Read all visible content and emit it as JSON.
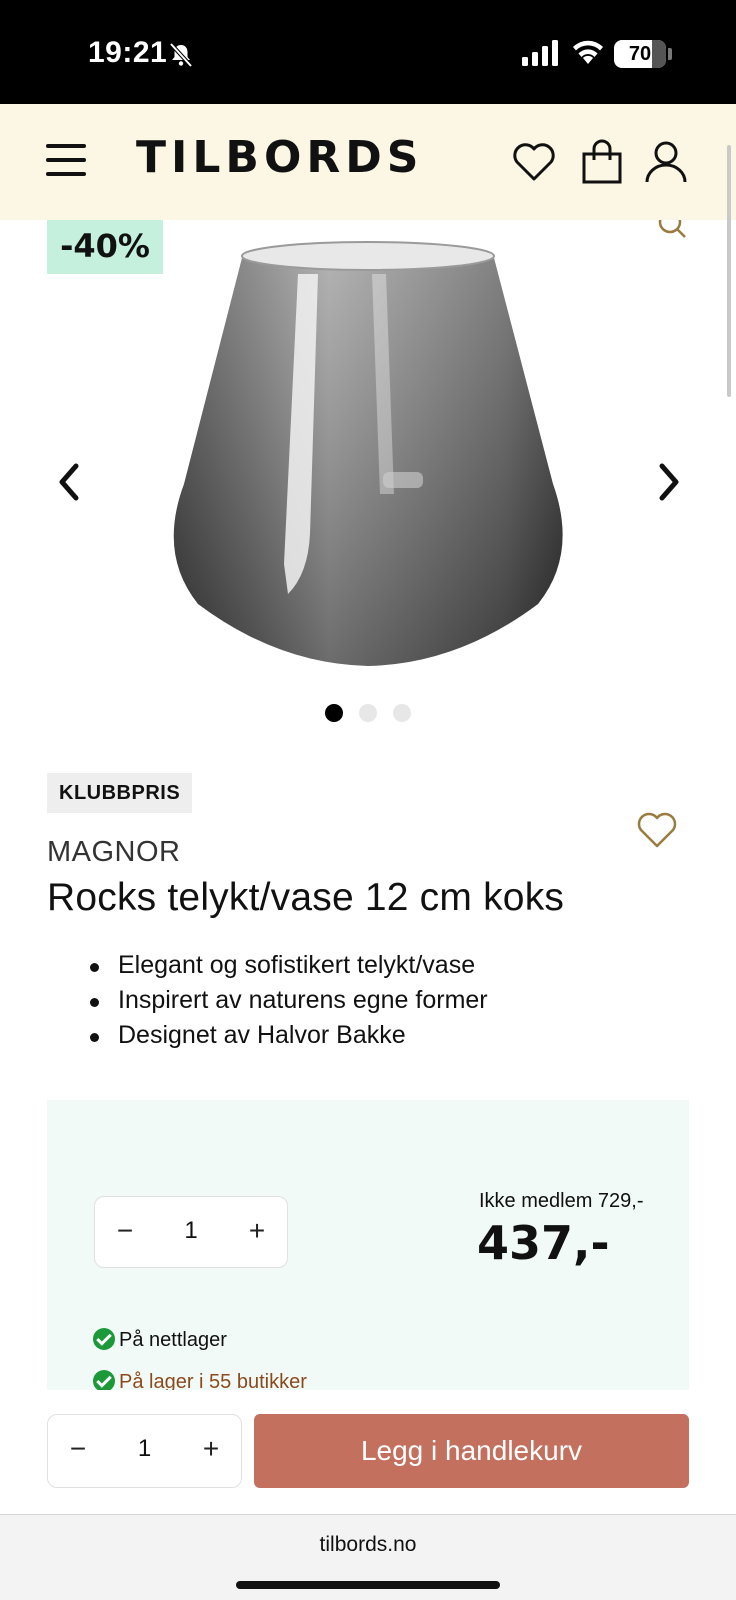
{
  "status_bar": {
    "time": "19:21",
    "battery": "70"
  },
  "header": {
    "logo": "TILBORDS",
    "icons": [
      "menu-icon",
      "heart-icon",
      "shopping-bag-icon",
      "user-icon"
    ]
  },
  "gallery": {
    "discount": "-40%",
    "slide_count": 3,
    "active_slide": 1
  },
  "product": {
    "badge": "KLUBBPRIS",
    "brand": "MAGNOR",
    "title": "Rocks telykt/vase 12 cm koks",
    "features": [
      "Elegant og sofistikert telykt/vase",
      "Inspirert av naturens egne former",
      "Designet av Halvor Bakke"
    ]
  },
  "purchase": {
    "quantity": "1",
    "minus": "−",
    "plus": "+",
    "nonmember_price": "Ikke medlem 729,-",
    "price": "437,-",
    "stock_online": "På nettlager",
    "stock_stores": "På lager i 55 butikker"
  },
  "sticky": {
    "quantity": "1",
    "minus": "−",
    "plus": "+",
    "add_to_cart": "Legg i handlekurv"
  },
  "browser": {
    "url": "tilbords.no"
  },
  "colors": {
    "header_bg": "#fcf6e4",
    "discount_bg": "#c4f0dd",
    "panel_bg": "#f1faf6",
    "add_to_cart": "#c3705f",
    "accent_heart": "#9a7a3e",
    "stock_check": "#1c9a3a"
  }
}
